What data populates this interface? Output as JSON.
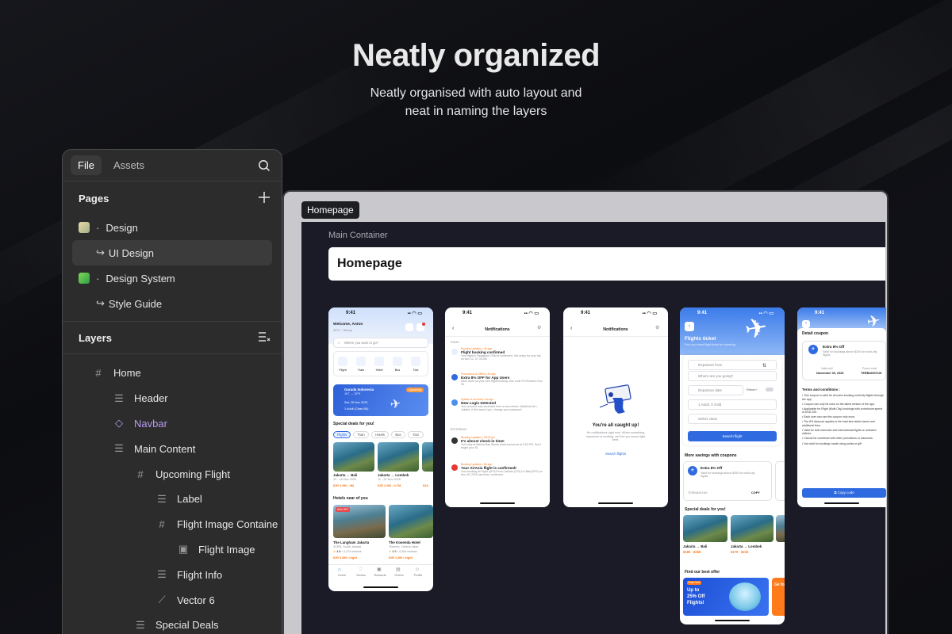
{
  "header": {
    "title": "Neatly organized",
    "subtitle_line1": "Neatly organised with auto layout and",
    "subtitle_line2": "neat in naming the layers"
  },
  "panel": {
    "tabs": [
      {
        "label": "File"
      },
      {
        "label": "Assets"
      }
    ],
    "pages_title": "Pages",
    "pages": [
      {
        "label": "Design"
      },
      {
        "label": "UI Design"
      },
      {
        "label": "Design System"
      },
      {
        "label": "Style Guide"
      }
    ],
    "layers_title": "Layers",
    "layers": [
      {
        "label": "Home"
      },
      {
        "label": "Header"
      },
      {
        "label": "Navbar"
      },
      {
        "label": "Main Content"
      },
      {
        "label": "Upcoming Flight"
      },
      {
        "label": "Label"
      },
      {
        "label": "Flight Image Containe"
      },
      {
        "label": "Flight Image"
      },
      {
        "label": "Flight Info"
      },
      {
        "label": "Vector 6"
      },
      {
        "label": "Special Deals"
      }
    ],
    "navbar_color": "#b89cf0"
  },
  "canvas": {
    "frame_tag": "Homepage",
    "container_label": "Main Container",
    "container_title": "Homepage"
  },
  "phones": {
    "time": "9:41",
    "home": {
      "welcome": "Welcome, Anton",
      "weather": "28°C · Sunny",
      "search": "Where you want to go?",
      "cats": [
        "Flight",
        "Train",
        "Hotel",
        "Bus",
        "Taxi"
      ],
      "card_title": "Garuda Indonesia",
      "card_route": "JKT → DPS",
      "card_badge": "Upcoming",
      "card_date": "Sat, 28 Nov 2025",
      "card_pax": "1 Adult (Class B4)",
      "deals_title": "Special deals for you!",
      "deal_tabs": [
        "Flights",
        "Train",
        "Hotels",
        "Bus",
        "Taxi"
      ],
      "deals": [
        {
          "route": "Jakarta → Bali",
          "date": "12 - 16 Nov 2025",
          "price": "IDR 2.9M - 4M"
        },
        {
          "route": "Jakarta → Lombok",
          "date": "11 - 20 Nov 2025",
          "price": "IDR 2.6M - 3.7M"
        },
        {
          "route": "",
          "date": "",
          "price": "$18"
        }
      ],
      "hotels_title": "Hotels near of you",
      "hotel_badge": "40% OFF",
      "hotels": [
        {
          "name": "The Langham Jakarta",
          "loc": "SCBD, South Jakarta",
          "rating": "4.8",
          "reviews": "• 3,274 reviews",
          "price": "IDR 3.8M / night"
        },
        {
          "name": "The Kosenda Hotel",
          "loc": "Thamrin, Central Jakar",
          "rating": "4.9",
          "reviews": "• 4,300 reviews",
          "price": "IDR 1.8M / night"
        }
      ],
      "tabs": [
        "Home",
        "Stories",
        "Rewards",
        "Orders",
        "Profile"
      ]
    },
    "notif": {
      "title": "Notifications",
      "today": "TODAY",
      "yesterday": "YESTERDAY",
      "items": [
        {
          "cat": "Booking Updates • 3h ago",
          "title": "Flight booking confirmed",
          "body": "Your flight to Singapore GMd is confirmed. Get ready for your trip on Nov 12, 07.30 AM"
        },
        {
          "cat": "Promotions & Offers • 2d ago",
          "title": "Extra 8% OFF for App Users",
          "body": "Save more on your next flight booking. Use code FLY8 before Nov 30."
        },
        {
          "cat": "System & Account • 4d ago",
          "title": "New Login Detected",
          "body": "Your account was accessed from a new device: MacBook Air • Jakarta. If this wasn't you, change your password."
        },
        {
          "cat": "Booking Updates • 08:00 pm",
          "title": "It's almost check-in time!",
          "body": "Your stay at Marina Bay Sands starts tomorrow at 3:00 PM. Don't forget your ID."
        },
        {
          "cat": "Booking Updates • 8h ago",
          "title": "Your AirAsia flight is confirmed!",
          "body": "Your booking for flight QZ142 from Jakarta (CGK) to Bali (DPS) on Nov 25, 2025 has been confirmed."
        }
      ]
    },
    "empty": {
      "title": "Notifications",
      "heading": "You're all caught up!",
      "body": "No notifications right now. When something important or exciting, we'll let you know right here.",
      "link": "Search flights"
    },
    "flights": {
      "title": "Flights ticket",
      "subtitle": "Find your best flight ticket for traveling",
      "fields": [
        "Departure from",
        "Where are you going?",
        "Departure date",
        "1 Adult, 0 child",
        "Select class"
      ],
      "return_label": "Return?",
      "button": "Search flight",
      "coupons_title": "More savings with coupons",
      "coupon_title": "Extra 8% Off",
      "coupon_desc": "Valid for bookings above $200 for multi-city flights",
      "coupon_code": "TERBANGYUK",
      "coupon_copy": "COPY",
      "deals_title": "Special deals for you!",
      "deals": [
        {
          "route": "Jakarta → Bali",
          "price": "$180 - $255"
        },
        {
          "route": "Jakarta → Lombok",
          "price": "$170 - $233"
        }
      ],
      "offer_title": "Find our best offer",
      "offer_badge": "Flash Sale",
      "offer_text1": "Up to",
      "offer_text2": "25% Off",
      "offer_text3": "Flights!",
      "offer_side": "Ge fo"
    },
    "coupon": {
      "title": "Detail coupon",
      "name": "Extra 8% Off",
      "desc": "Valid for bookings above $200 for multi-city flights",
      "valid_label": "Valid until",
      "valid_value": "November 30, 2025",
      "code_label": "Promo code",
      "code_value": "TERBANGYUK",
      "terms_title": "Terms and conditions :",
      "terms": [
        "This coupon is valid for all users booking multi-city flights through the app.",
        "Coupon can only be used on the latest version of the app.",
        "Applicable for Flight (Multi City) bookings with a minimum spend of USD 200.",
        "Each user can use this coupon only once.",
        "The 8% discount applies to the total fare before taxes and additional fees.",
        "Valid for both domestic and international flights on selected airlines.",
        "Cannot be combined with other promotions or discounts.",
        "Not valid for bookings made using points or gift"
      ],
      "button": "Copy code"
    }
  }
}
